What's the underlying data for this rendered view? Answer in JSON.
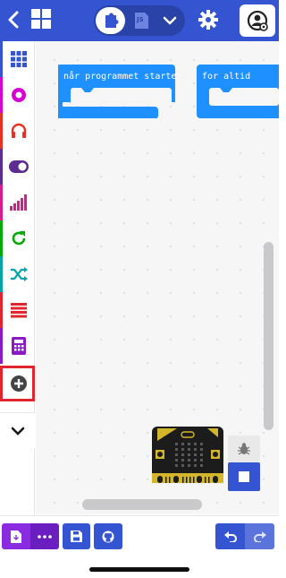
{
  "header": {
    "back_icon": "chevron-left-icon",
    "logo_icon": "microsoft-logo-icon",
    "editor_toggle": {
      "blocks_icon": "puzzle-piece-icon",
      "js_label": "JS",
      "dropdown_icon": "chevron-down-icon"
    },
    "settings_icon": "gear-icon",
    "user_icon": "user-avatar-icon"
  },
  "toolbox": {
    "categories": [
      {
        "name": "grid",
        "icon": "grid-icon",
        "color": "#3454d1"
      },
      {
        "name": "radio",
        "icon": "radio-icon",
        "color": "#d400d4"
      },
      {
        "name": "music",
        "icon": "headphones-icon",
        "color": "#e63022"
      },
      {
        "name": "input",
        "icon": "toggle-icon",
        "color": "#5c2d91"
      },
      {
        "name": "led",
        "icon": "signal-icon",
        "color": "#d81b8e"
      },
      {
        "name": "loops",
        "icon": "refresh-icon",
        "color": "#00aa00"
      },
      {
        "name": "logic",
        "icon": "shuffle-icon",
        "color": "#00a4a6"
      },
      {
        "name": "arrays",
        "icon": "list-icon",
        "color": "#e0252e"
      },
      {
        "name": "math",
        "icon": "calculator-icon",
        "color": "#8c1ac4"
      },
      {
        "name": "extensions",
        "icon": "plus-circle-icon",
        "color": "#444444"
      }
    ],
    "more_icon": "chevron-down-icon"
  },
  "workspace": {
    "blocks": [
      {
        "label": "når programmet starter"
      },
      {
        "label": "for altid"
      }
    ]
  },
  "simulator": {
    "debug_icon": "bug-icon",
    "stop_icon": "stop-icon"
  },
  "bottombar": {
    "download_icon": "download-file-icon",
    "more_icon": "ellipsis-icon",
    "save_icon": "floppy-disk-icon",
    "github_icon": "github-icon",
    "undo_icon": "undo-icon",
    "redo_icon": "redo-icon"
  },
  "colors": {
    "primary": "#3454d1",
    "block": "#1e90ff",
    "download": "#8a2be2",
    "selection": "#e0252e"
  }
}
